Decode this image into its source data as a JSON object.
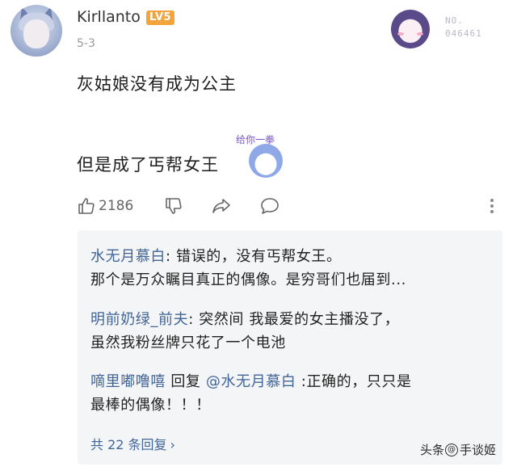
{
  "header": {
    "username": "Kirllanto",
    "level_badge": "LV5",
    "date": "5-3",
    "fan_badge_no": "NO.",
    "fan_badge_number": "046461"
  },
  "comment": {
    "line1": "灰姑娘没有成为公主",
    "line2": "但是成了丐帮女王",
    "sticker_caption": "给你一拳"
  },
  "actions": {
    "like_count": "2186"
  },
  "replies": [
    {
      "name": "水无月慕白",
      "sep": ": ",
      "text1": "错误的，没有丐帮女王。",
      "text2": "那个是万众瞩目真正的偶像。是穷哥们也届到..."
    },
    {
      "name": "明前奶绿_前夫",
      "sep": ": ",
      "text1": "突然间 我最爱的女主播没了，",
      "text2": "虽然我粉丝牌只花了一个电池"
    },
    {
      "name": "嘀里嘟噜嘻",
      "reply_word": " 回复 ",
      "at": "@水无月慕白",
      "sep": " :",
      "text1": "正确的，只只是",
      "text2": "最棒的偶像！！！"
    }
  ],
  "replies_total": "共 22 条回复",
  "watermark": {
    "prefix": "头条",
    "circle": "@",
    "name": "手谈姬"
  }
}
